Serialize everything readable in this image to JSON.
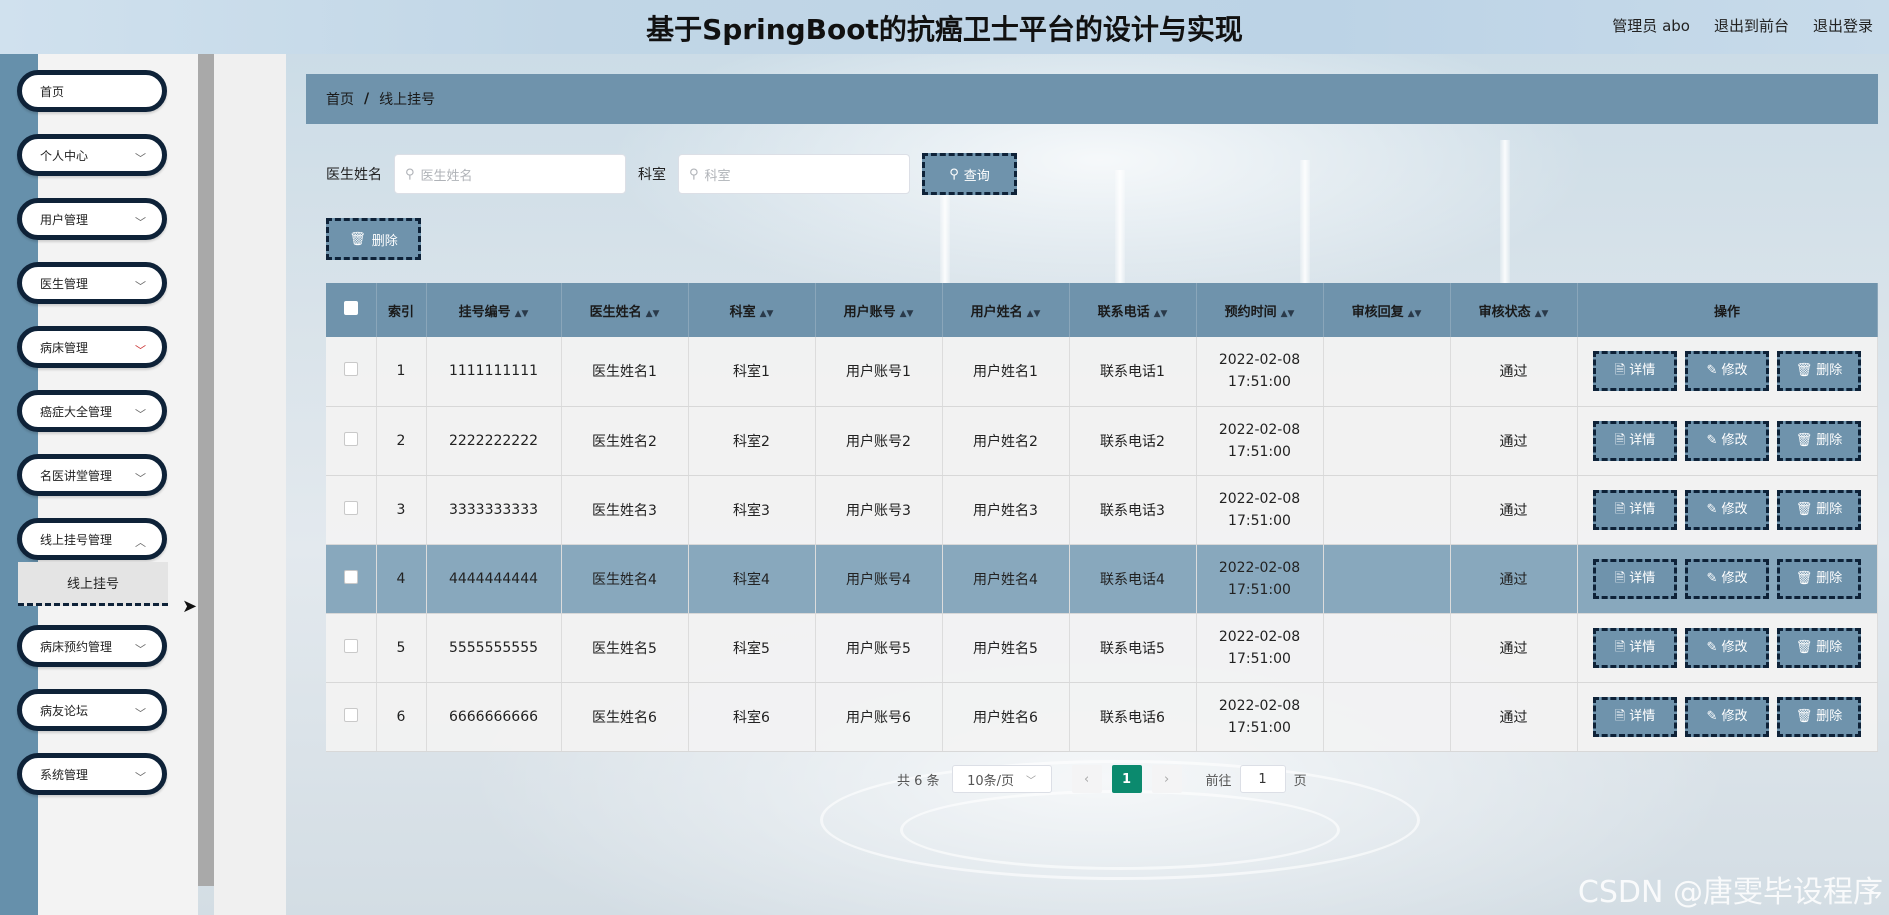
{
  "header": {
    "title": "基于SpringBoot的抗癌卫士平台的设计与实现",
    "admin": "管理员 abo",
    "exit_front": "退出到前台",
    "logout": "退出登录"
  },
  "sidebar": {
    "items": [
      {
        "label": "首页"
      },
      {
        "label": "个人中心"
      },
      {
        "label": "用户管理"
      },
      {
        "label": "医生管理"
      },
      {
        "label": "病床管理"
      },
      {
        "label": "癌症大全管理"
      },
      {
        "label": "名医讲堂管理"
      },
      {
        "label": "线上挂号管理"
      },
      {
        "label": "病床预约管理"
      },
      {
        "label": "病友论坛"
      },
      {
        "label": "系统管理"
      }
    ],
    "submenu_active": "线上挂号"
  },
  "breadcrumb": {
    "home": "首页",
    "separator": "/",
    "current": "线上挂号"
  },
  "search": {
    "doctor_label": "医生姓名",
    "doctor_placeholder": "医生姓名",
    "dept_label": "科室",
    "dept_placeholder": "科室",
    "query_button": "查询"
  },
  "toolbar": {
    "delete_button": "删除"
  },
  "table": {
    "headers": [
      "索引",
      "挂号编号",
      "医生姓名",
      "科室",
      "用户账号",
      "用户姓名",
      "联系电话",
      "预约时间",
      "审核回复",
      "审核状态",
      "操作"
    ],
    "rows": [
      {
        "index": "1",
        "code": "1111111111",
        "doctor": "医生姓名1",
        "dept": "科室1",
        "account": "用户账号1",
        "user": "用户姓名1",
        "phone": "联系电话1",
        "time": "2022-02-08 17:51:00",
        "reply": "",
        "status": "通过"
      },
      {
        "index": "2",
        "code": "2222222222",
        "doctor": "医生姓名2",
        "dept": "科室2",
        "account": "用户账号2",
        "user": "用户姓名2",
        "phone": "联系电话2",
        "time": "2022-02-08 17:51:00",
        "reply": "",
        "status": "通过"
      },
      {
        "index": "3",
        "code": "3333333333",
        "doctor": "医生姓名3",
        "dept": "科室3",
        "account": "用户账号3",
        "user": "用户姓名3",
        "phone": "联系电话3",
        "time": "2022-02-08 17:51:00",
        "reply": "",
        "status": "通过"
      },
      {
        "index": "4",
        "code": "4444444444",
        "doctor": "医生姓名4",
        "dept": "科室4",
        "account": "用户账号4",
        "user": "用户姓名4",
        "phone": "联系电话4",
        "time": "2022-02-08 17:51:00",
        "reply": "",
        "status": "通过"
      },
      {
        "index": "5",
        "code": "5555555555",
        "doctor": "医生姓名5",
        "dept": "科室5",
        "account": "用户账号5",
        "user": "用户姓名5",
        "phone": "联系电话5",
        "time": "2022-02-08 17:51:00",
        "reply": "",
        "status": "通过"
      },
      {
        "index": "6",
        "code": "6666666666",
        "doctor": "医生姓名6",
        "dept": "科室6",
        "account": "用户账号6",
        "user": "用户姓名6",
        "phone": "联系电话6",
        "time": "2022-02-08 17:51:00",
        "reply": "",
        "status": "通过"
      }
    ],
    "actions": {
      "detail": "详情",
      "edit": "修改",
      "delete": "删除"
    }
  },
  "pager": {
    "total": "共 6 条",
    "page_size": "10条/页",
    "current_page": "1",
    "goto_label": "前往",
    "goto_value": "1",
    "page_suffix": "页"
  },
  "watermark": "CSDN @唐雯毕设程序",
  "colors": {
    "accent": "#6f93ac",
    "border_dark": "#0e2238",
    "page_active": "#0b8a6e"
  }
}
